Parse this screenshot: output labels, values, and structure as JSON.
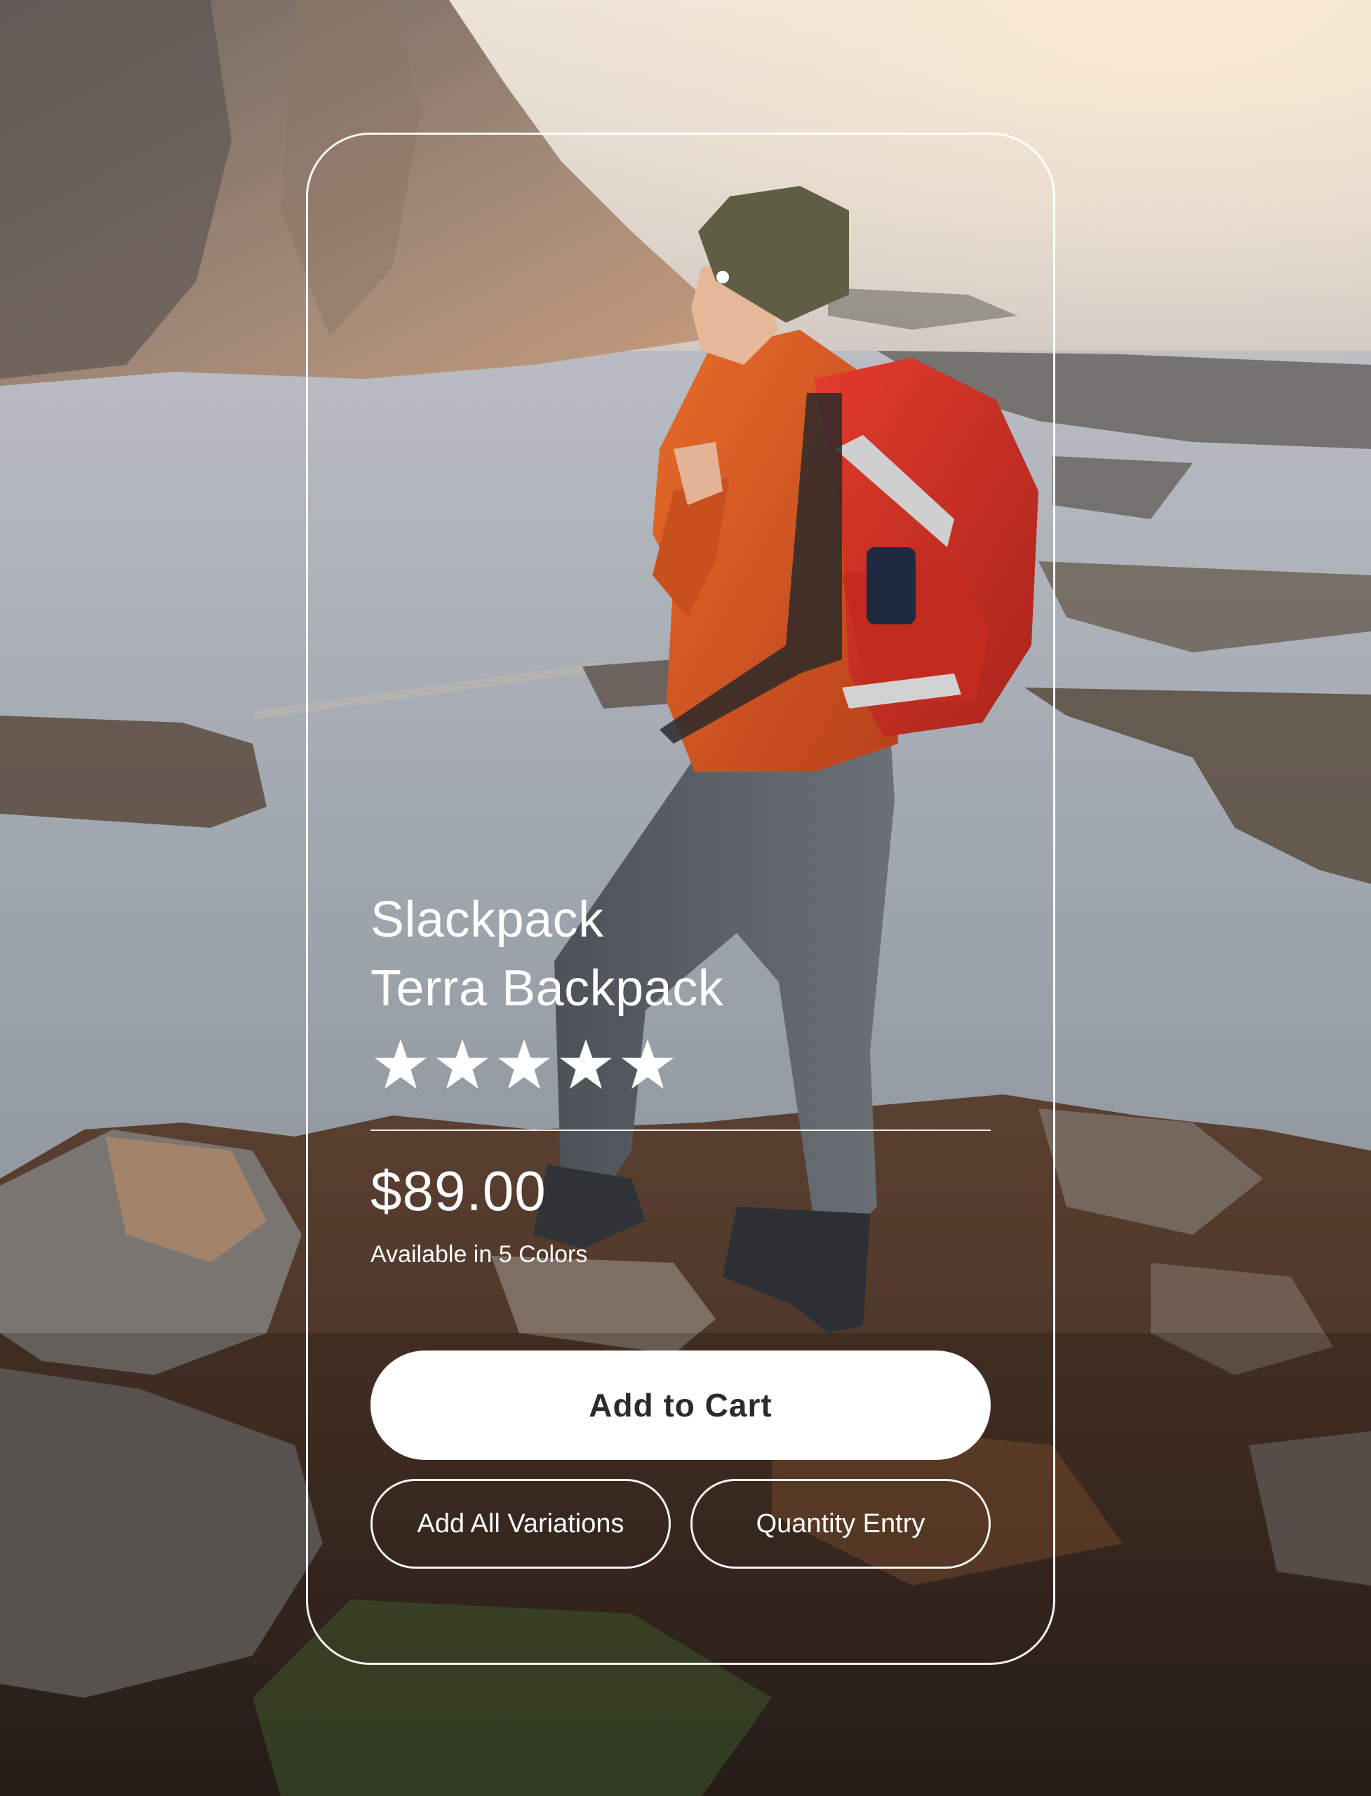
{
  "product": {
    "brand": "Slackpack",
    "name": "Terra Backpack",
    "rating": 5,
    "rating_max": 5,
    "price": "$89.00",
    "availability": "Available in 5 Colors"
  },
  "actions": {
    "add_to_cart": "Add to Cart",
    "add_all_variations": "Add All Variations",
    "quantity_entry": "Quantity Entry"
  },
  "icons": {
    "star": "star-icon"
  },
  "colors": {
    "card_border": "#ffffff",
    "primary_button_bg": "#ffffff",
    "primary_button_text": "#2b2b2b",
    "text": "#ffffff"
  }
}
